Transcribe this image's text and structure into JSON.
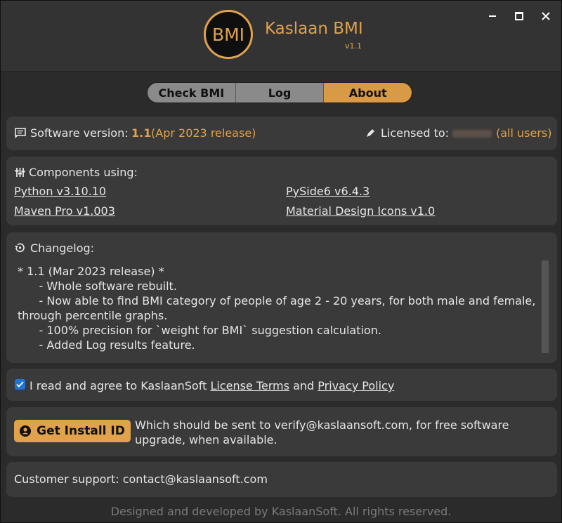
{
  "window": {
    "logo_text": "BMI",
    "app_name": "Kaslaan BMI",
    "app_version": "v1.1"
  },
  "tabs": [
    {
      "label": "Check BMI",
      "active": false
    },
    {
      "label": "Log",
      "active": false
    },
    {
      "label": "About",
      "active": true
    }
  ],
  "version_panel": {
    "label": "Software version:",
    "version": "1.1",
    "release": "(Apr 2023 release)",
    "license_label": "Licensed to:",
    "license_scope": "(all users)",
    "icons": {
      "version": "notes-icon",
      "license": "pen-icon"
    }
  },
  "components": {
    "title": "Components using:",
    "items": [
      "Python v3.10.10",
      "PySide6 v6.4.3",
      "Maven Pro v1.003",
      "Material Design Icons v1.0"
    ]
  },
  "changelog": {
    "title": "Changelog:",
    "text": "* 1.1 (Mar 2023 release) *\n      - Whole software rebuilt.\n      - Now able to find BMI category of people of age 2 - 20 years, for both male and female, through percentile graphs.\n      - 100% precision for `weight for BMI` suggestion calculation.\n      - Added Log results feature."
  },
  "agreement": {
    "checked": true,
    "prefix": "I read and agree to KaslaanSoft",
    "license_link": "License Terms",
    "and": "and",
    "privacy_link": "Privacy Policy"
  },
  "install": {
    "button_label": "Get Install ID",
    "description": "Which should be sent to verify@kaslaansoft.com, for free software upgrade, when available."
  },
  "support": {
    "text": "Customer support: contact@kaslaansoft.com"
  },
  "footer": {
    "text": "Designed and developed by KaslaanSoft. All rights reserved."
  },
  "colors": {
    "accent": "#e0a24a",
    "background": "#2b2b2b",
    "panel": "#3a3a3a",
    "checkbox": "#1d74d8"
  }
}
